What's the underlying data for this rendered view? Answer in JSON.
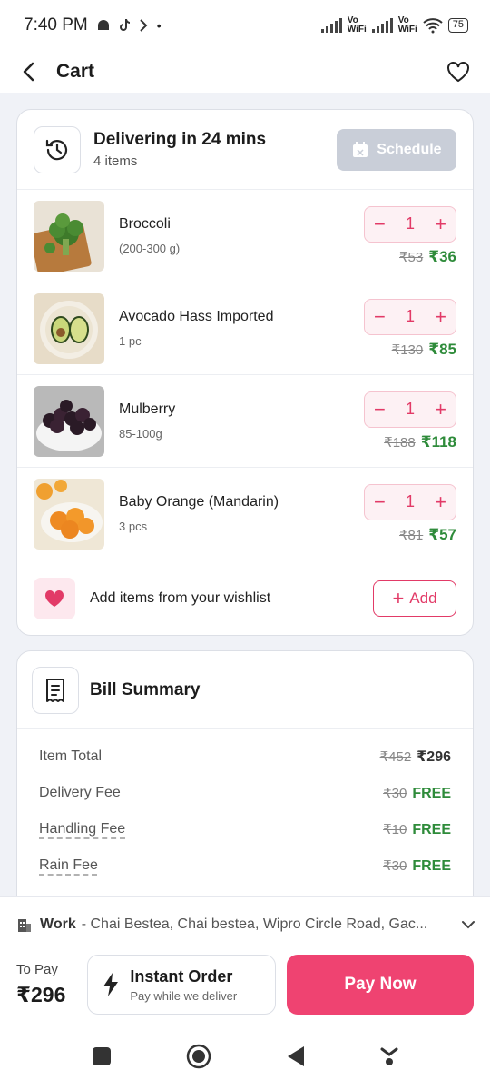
{
  "status": {
    "time": "7:40 PM",
    "battery": "75",
    "vo1": "Vo",
    "wifi1": "WiFi",
    "vo2": "Vo",
    "wifi2": "WiFi"
  },
  "header": {
    "title": "Cart"
  },
  "delivery": {
    "title": "Delivering in 24 mins",
    "subtitle": "4 items",
    "schedule_label": "Schedule"
  },
  "items": [
    {
      "name": "Broccoli",
      "qty": "(200-300 g)",
      "count": "1",
      "mrp": "₹53",
      "price": "₹36"
    },
    {
      "name": "Avocado Hass Imported",
      "qty": "1 pc",
      "count": "1",
      "mrp": "₹130",
      "price": "₹85"
    },
    {
      "name": "Mulberry",
      "qty": "85-100g",
      "count": "1",
      "mrp": "₹188",
      "price": "₹118"
    },
    {
      "name": "Baby Orange (Mandarin)",
      "qty": "3 pcs",
      "count": "1",
      "mrp": "₹81",
      "price": "₹57"
    }
  ],
  "wishlist": {
    "text": "Add items from your wishlist",
    "add_label": "Add"
  },
  "bill": {
    "title": "Bill Summary",
    "rows": [
      {
        "label": "Item Total",
        "strike": "₹452",
        "value": "₹296"
      },
      {
        "label": "Delivery Fee",
        "strike": "₹30",
        "value": "FREE"
      },
      {
        "label": "Handling Fee",
        "strike": "₹10",
        "value": "FREE"
      },
      {
        "label": "Rain Fee",
        "strike": "₹30",
        "value": "FREE"
      }
    ]
  },
  "address": {
    "tag": "Work",
    "text": "- Chai Bestea, Chai bestea, Wipro Circle Road, Gac..."
  },
  "payment": {
    "to_pay_label": "To Pay",
    "to_pay_value": "₹296",
    "instant_title": "Instant Order",
    "instant_sub": "Pay while we deliver",
    "pay_now": "Pay Now"
  },
  "colors": {
    "accent": "#ef4371",
    "green": "#2e8b3a",
    "bg": "#f0f2f7"
  }
}
